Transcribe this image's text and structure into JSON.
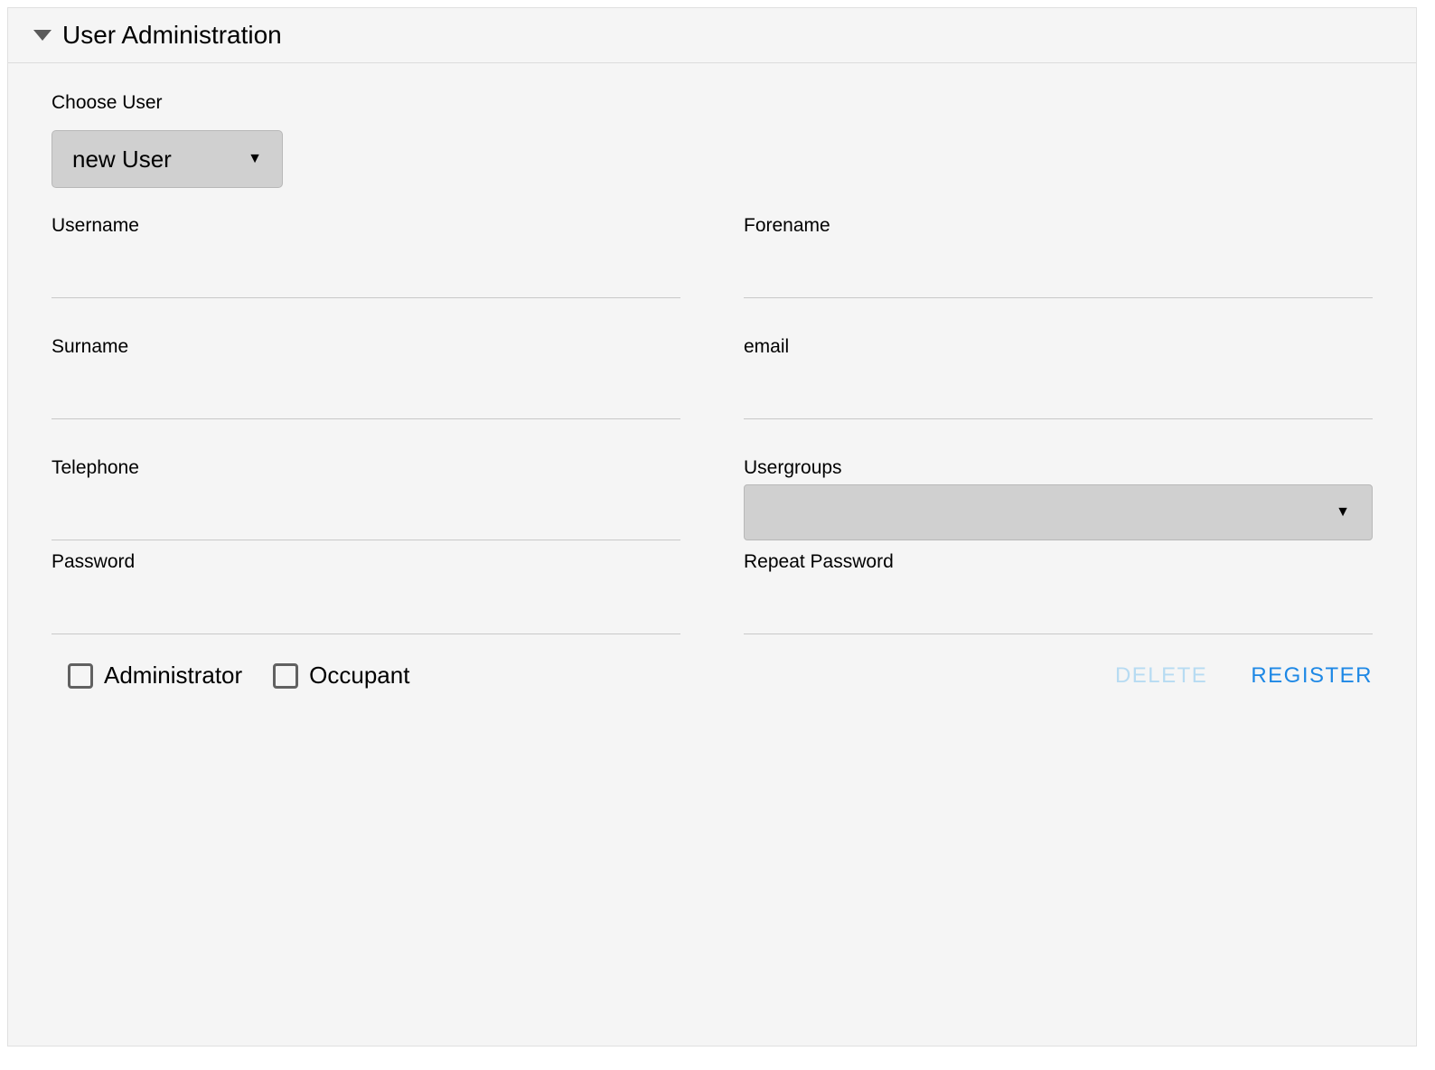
{
  "panel": {
    "title": "User Administration"
  },
  "choose_user": {
    "label": "Choose User",
    "selected": "new User"
  },
  "fields": {
    "username": {
      "label": "Username",
      "value": ""
    },
    "forename": {
      "label": "Forename",
      "value": ""
    },
    "surname": {
      "label": "Surname",
      "value": ""
    },
    "email": {
      "label": "email",
      "value": ""
    },
    "telephone": {
      "label": "Telephone",
      "value": ""
    },
    "usergroups": {
      "label": "Usergroups",
      "selected": ""
    },
    "password": {
      "label": "Password",
      "value": ""
    },
    "repeat_password": {
      "label": "Repeat Password",
      "value": ""
    }
  },
  "roles": {
    "administrator": {
      "label": "Administrator",
      "checked": false
    },
    "occupant": {
      "label": "Occupant",
      "checked": false
    }
  },
  "actions": {
    "delete": "DELETE",
    "register": "REGISTER"
  }
}
